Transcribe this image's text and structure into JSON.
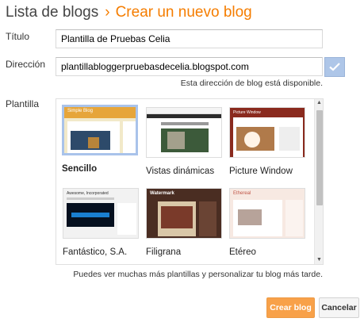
{
  "header": {
    "breadcrumb": "Lista de blogs",
    "separator": "›",
    "current": "Crear un nuevo blog"
  },
  "form": {
    "title_label": "Título",
    "title_value": "Plantilla de Pruebas Celia",
    "address_label": "Dirección",
    "address_value": "plantillabloggerpruebasdecelia.blogspot.com",
    "availability": "Esta dirección de blog está disponible.",
    "template_label": "Plantilla"
  },
  "templates": [
    {
      "name": "Sencillo",
      "selected": true
    },
    {
      "name": "Vistas dinámicas",
      "selected": false
    },
    {
      "name": "Picture Window",
      "selected": false
    },
    {
      "name": "Fantástico, S.A.",
      "selected": false
    },
    {
      "name": "Filigrana",
      "selected": false
    },
    {
      "name": "Etéreo",
      "selected": false
    }
  ],
  "thumb_text": {
    "simple_blog": "Simple Blog",
    "picture_window": "Picture Window",
    "awesome_inc": "Awesome, Incorporated",
    "watermark": "Watermark",
    "ethereal": "Ethereal"
  },
  "footnote": "Puedes ver muchas más plantillas y personalizar tu blog más tarde.",
  "actions": {
    "create": "Crear blog",
    "cancel": "Cancelar"
  },
  "colors": {
    "accent": "#f57d00",
    "primary_button": "#f8a149",
    "check_button": "#aec6e8",
    "selected_border": "#a9c3ea"
  }
}
